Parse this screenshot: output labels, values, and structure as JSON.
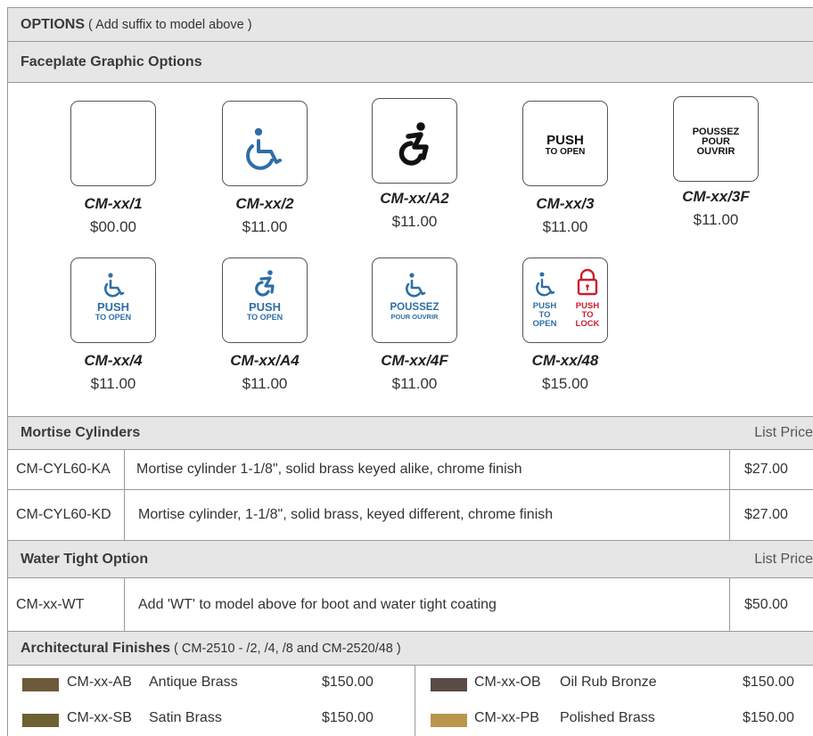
{
  "options_header": {
    "title": "OPTIONS",
    "subtitle": "( Add suffix to model above )"
  },
  "faceplate_header": {
    "title": "Faceplate Graphic Options"
  },
  "faceplates": [
    {
      "code": "CM-xx/1",
      "price": "$00.00"
    },
    {
      "code": "CM-xx/2",
      "price": "$11.00"
    },
    {
      "code": "CM-xx/A2",
      "price": "$11.00"
    },
    {
      "code": "CM-xx/3",
      "price": "$11.00",
      "text1": "PUSH",
      "text2": "TO OPEN"
    },
    {
      "code": "CM-xx/3F",
      "price": "$11.00",
      "text1": "POUSSEZ",
      "text2": "POUR",
      "text3": "OUVRIR"
    },
    {
      "code": "CM-xx/4",
      "price": "$11.00",
      "text1": "PUSH",
      "text2": "TO OPEN"
    },
    {
      "code": "CM-xx/A4",
      "price": "$11.00",
      "text1": "PUSH",
      "text2": "TO OPEN"
    },
    {
      "code": "CM-xx/4F",
      "price": "$11.00",
      "text1": "POUSSEZ",
      "text2": "POUR OUVRIR"
    },
    {
      "code": "CM-xx/48",
      "price": "$15.00",
      "left": [
        "PUSH",
        "TO",
        "OPEN"
      ],
      "right": [
        "PUSH",
        "TO",
        "LOCK"
      ]
    }
  ],
  "mortise": {
    "title": "Mortise Cylinders",
    "list_price_label": "List Price",
    "rows": [
      {
        "sku": "CM-CYL60-KA",
        "desc": "Mortise cylinder 1-1/8\", solid brass keyed alike, chrome finish",
        "price": "$27.00"
      },
      {
        "sku": "CM-CYL60-KD",
        "desc": "Mortise cylinder, 1-1/8\", solid brass, keyed different, chrome finish",
        "price": "$27.00"
      }
    ]
  },
  "water": {
    "title": "Water Tight Option",
    "list_price_label": "List Price",
    "rows": [
      {
        "sku": "CM-xx-WT",
        "desc": "Add 'WT' to model above for boot and water tight coating",
        "price": "$50.00"
      }
    ]
  },
  "finishes": {
    "title": "Architectural Finishes",
    "subtitle": "( CM-2510 - /2, /4, /8 and CM-2520/48 )",
    "items": [
      {
        "code": "CM-xx-AB",
        "name": "Antique Brass",
        "price": "$150.00",
        "color": "#6e5a3a"
      },
      {
        "code": "CM-xx-OB",
        "name": "Oil Rub Bronze",
        "price": "$150.00",
        "color": "#5a4b44"
      },
      {
        "code": "CM-xx-SB",
        "name": "Satin Brass",
        "price": "$150.00",
        "color": "#6c6133"
      },
      {
        "code": "CM-xx-PB",
        "name": "Polished Brass",
        "price": "$150.00",
        "color": "#b8974d"
      }
    ]
  },
  "colors": {
    "header_bg": "#e6e6e6",
    "icon_blue": "#2e6ea6",
    "icon_red": "#c8202d",
    "border": "#9a9a9a"
  }
}
